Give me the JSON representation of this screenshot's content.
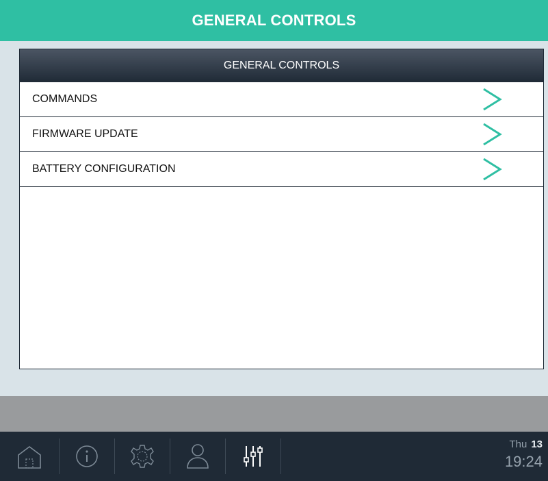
{
  "header": {
    "title": "GENERAL CONTROLS"
  },
  "panel": {
    "title": "GENERAL CONTROLS",
    "items": [
      {
        "label": "COMMANDS",
        "icon": "chevron-right-icon"
      },
      {
        "label": "FIRMWARE UPDATE",
        "icon": "chevron-right-icon"
      },
      {
        "label": "BATTERY CONFIGURATION",
        "icon": "chevron-right-icon"
      }
    ]
  },
  "nav": {
    "icons": [
      "home-icon",
      "info-icon",
      "settings-gear-icon",
      "user-icon",
      "sliders-icon"
    ],
    "active": "sliders-icon"
  },
  "clock": {
    "day": "Thu",
    "date": "13",
    "time": "19:24"
  },
  "colors": {
    "accent": "#2fbfa3",
    "header_dark": "#1f2a36",
    "nav_icon": "#7d8a96",
    "nav_icon_active": "#ffffff"
  }
}
